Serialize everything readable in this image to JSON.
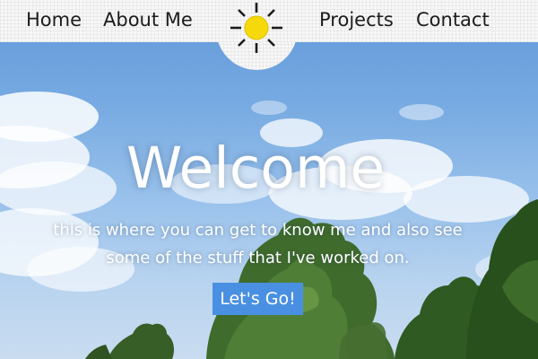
{
  "nav": {
    "links": [
      "Home",
      "About Me",
      "Projects",
      "Contact"
    ]
  },
  "logo": {
    "icon": "sun-icon",
    "colors": {
      "fill": "#f5d90a",
      "stroke": "#1c1c1c"
    }
  },
  "hero": {
    "title": "Welcome",
    "subtitle": "this is where you can get to know me and also see some of the stuff that I've worked on.",
    "cta_label": "Let's Go!"
  },
  "colors": {
    "accent": "#4a90e2",
    "nav_background": "#f7f7f7",
    "text_light": "#ffffff"
  }
}
